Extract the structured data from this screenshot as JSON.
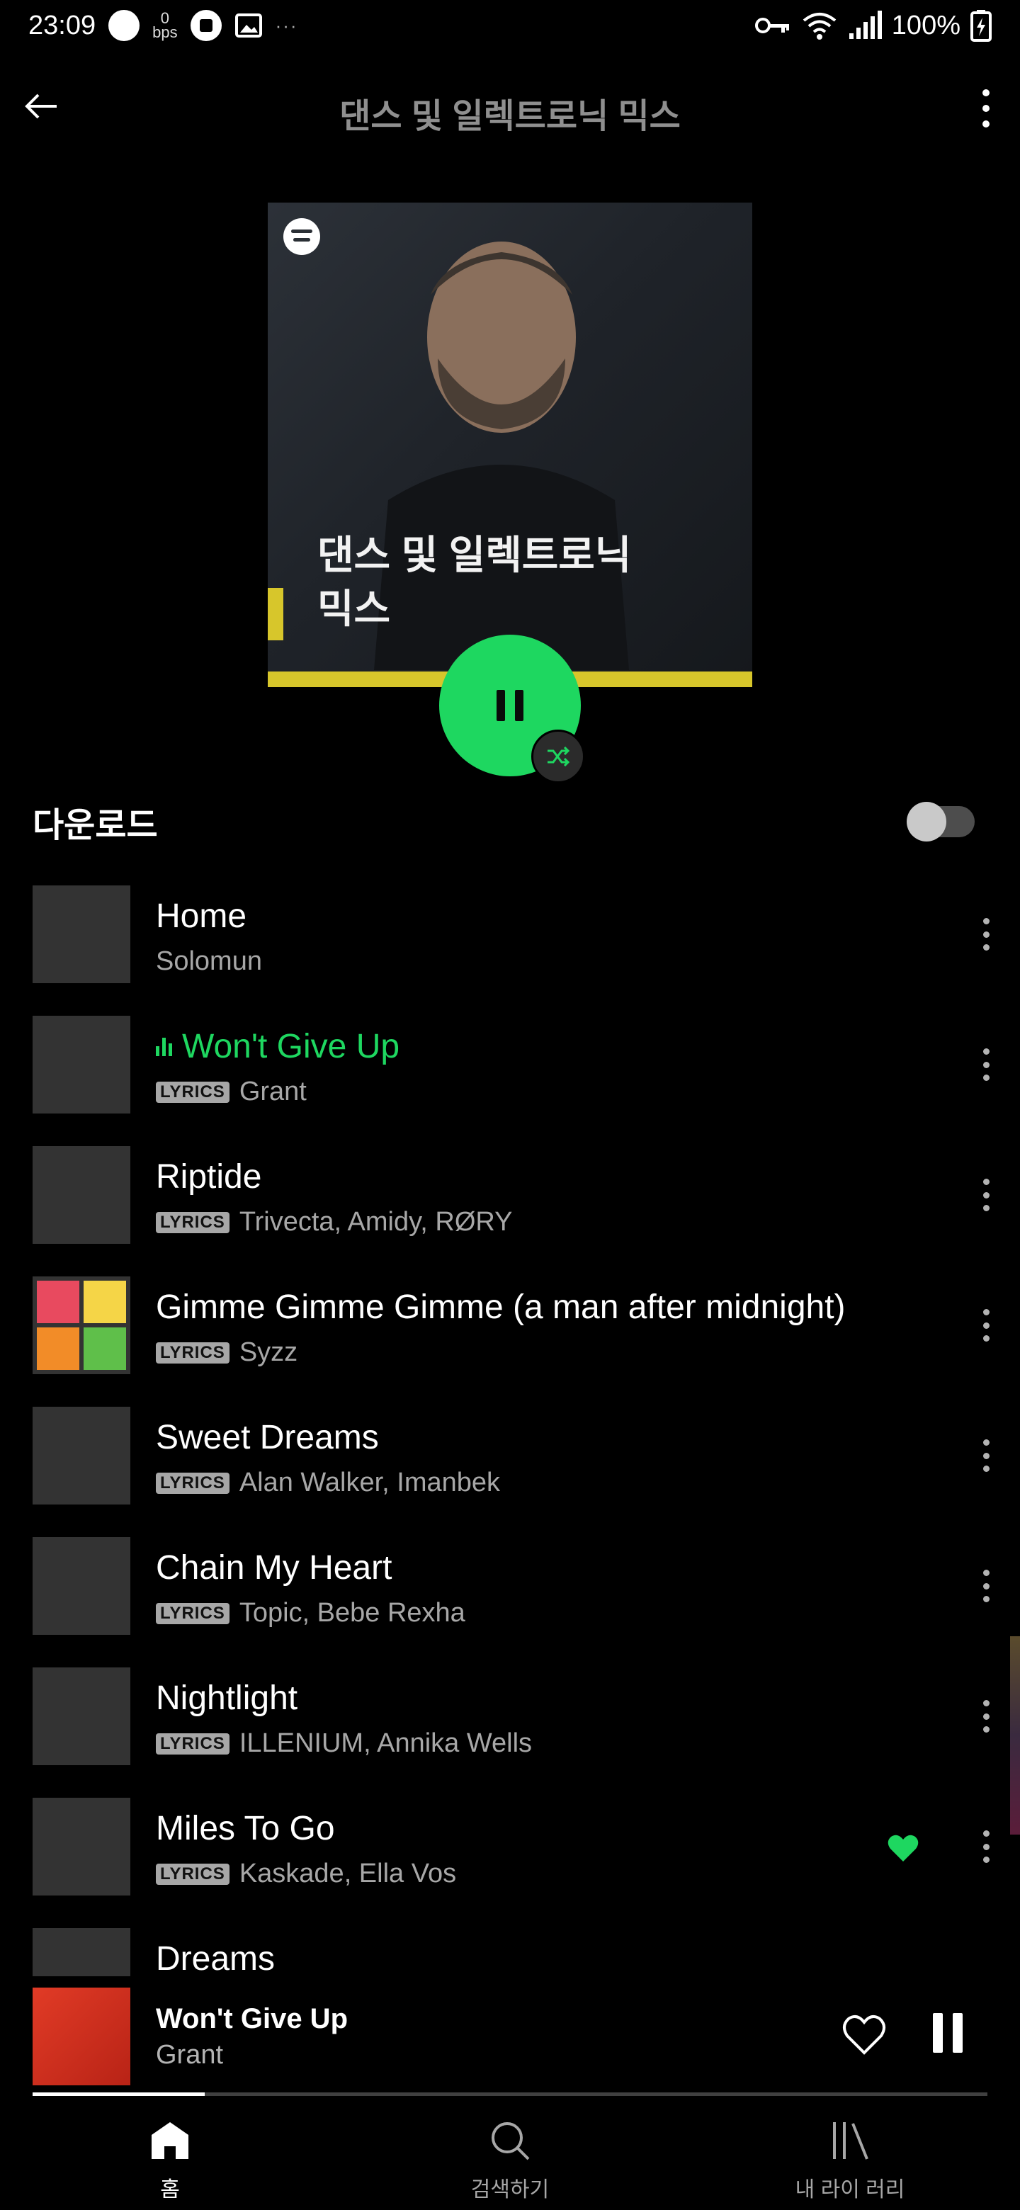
{
  "status_bar": {
    "time": "23:09",
    "speed_value": "0",
    "speed_unit": "bps",
    "battery": "100%",
    "more": "···"
  },
  "header": {
    "title": "댄스 및 일렉트로닉 믹스"
  },
  "cover": {
    "title_line1": "댄스 및 일렉트로닉",
    "title_line2": "믹스",
    "accent_color": "#d7c62b"
  },
  "download": {
    "label": "다운로드",
    "enabled": false
  },
  "lyrics_badge": "LYRICS",
  "tracks": [
    {
      "title": "Home",
      "artist": "Solomun",
      "lyrics": false,
      "playing": false,
      "liked": false
    },
    {
      "title": "Won't Give Up",
      "artist": "Grant",
      "lyrics": true,
      "playing": true,
      "liked": false
    },
    {
      "title": "Riptide",
      "artist": "Trivecta, Amidy, RØRY",
      "lyrics": true,
      "playing": false,
      "liked": false
    },
    {
      "title": "Gimme Gimme Gimme (a man after midnight)",
      "artist": "Syzz",
      "lyrics": true,
      "playing": false,
      "liked": false
    },
    {
      "title": "Sweet Dreams",
      "artist": "Alan Walker, Imanbek",
      "lyrics": true,
      "playing": false,
      "liked": false
    },
    {
      "title": "Chain My Heart",
      "artist": "Topic, Bebe Rexha",
      "lyrics": true,
      "playing": false,
      "liked": false
    },
    {
      "title": "Nightlight",
      "artist": "ILLENIUM, Annika Wells",
      "lyrics": true,
      "playing": false,
      "liked": false
    },
    {
      "title": "Miles To Go",
      "artist": "Kaskade, Ella Vos",
      "lyrics": true,
      "playing": false,
      "liked": true
    },
    {
      "title": "Dreams",
      "artist": "",
      "lyrics": false,
      "playing": false,
      "liked": false
    }
  ],
  "now_playing": {
    "title": "Won't Give Up",
    "artist": "Grant",
    "progress": 0.18
  },
  "nav": {
    "home": "홈",
    "search": "검색하기",
    "library": "내 라이 러리"
  },
  "colors": {
    "accent": "#1ed760",
    "background": "#000000"
  }
}
